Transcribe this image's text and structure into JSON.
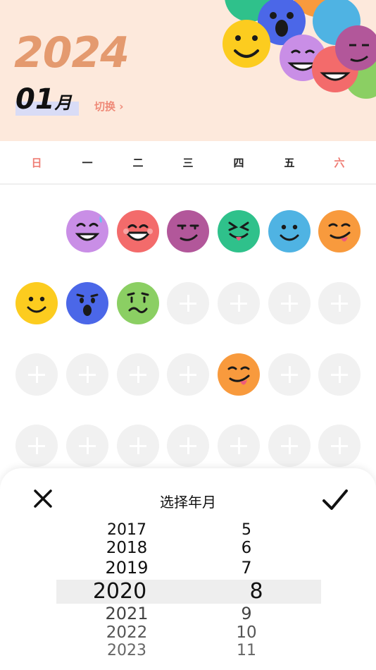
{
  "header": {
    "year": "2024",
    "month_number": "01",
    "month_unit": "月",
    "switch_label": "切换",
    "switch_arrow": "›"
  },
  "weekdays": [
    "日",
    "一",
    "二",
    "三",
    "四",
    "五",
    "六"
  ],
  "colors": {
    "header_bg": "#fde9dc",
    "year_text": "#e49a6f",
    "accent_red": "#ef7d74",
    "purple": "#c98ee6",
    "red": "#f36b6b",
    "plum": "#b2579a",
    "green": "#2fc18b",
    "blue": "#4fb3e3",
    "orange": "#f89a3d",
    "yellow": "#fccc1f",
    "royal": "#4b67e8",
    "lime": "#8bcf63"
  },
  "calendar": {
    "rows": [
      [
        null,
        "grinning-sweat",
        "laughing",
        "smirk",
        "tongue-squint",
        "wink",
        "tongue-wink"
      ],
      [
        "smile",
        "shocked",
        "confused",
        "add",
        "add",
        "add",
        "add"
      ],
      [
        "add",
        "add",
        "add",
        "add",
        "tongue-wink",
        "add",
        "add"
      ],
      [
        "add",
        "add",
        "add",
        "add",
        "add",
        "add",
        "add"
      ]
    ]
  },
  "picker": {
    "title": "选择年月",
    "close_icon": "close-icon",
    "confirm_icon": "checkmark-icon",
    "years": [
      "2017",
      "2018",
      "2019",
      "2020",
      "2021",
      "2022",
      "2023"
    ],
    "months": [
      "5",
      "6",
      "7",
      "8",
      "9",
      "10",
      "11"
    ],
    "selected_year": "2020",
    "selected_month": "8"
  }
}
